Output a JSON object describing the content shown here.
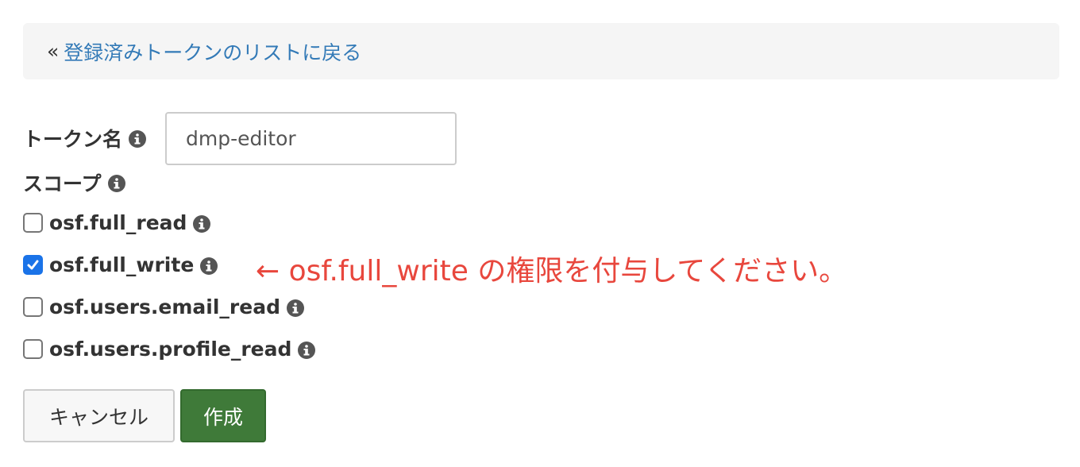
{
  "back_link": {
    "prefix": "«",
    "label": "登録済みトークンのリストに戻る"
  },
  "form": {
    "token_name_label": "トークン名",
    "token_name_value": "dmp-editor",
    "scope_label": "スコープ",
    "scopes": [
      {
        "label": "osf.full_read",
        "checked": false
      },
      {
        "label": "osf.full_write",
        "checked": true
      },
      {
        "label": "osf.users.email_read",
        "checked": false
      },
      {
        "label": "osf.users.profile_read",
        "checked": false
      }
    ]
  },
  "annotation": {
    "text": "← osf.full_write の権限を付与してください。",
    "color": "#e8473d"
  },
  "buttons": {
    "cancel_label": "キャンセル",
    "create_label": "作成"
  },
  "colors": {
    "link": "#337ab7",
    "create_button": "#3f7a39",
    "checkbox_checked": "#1a73e8"
  }
}
